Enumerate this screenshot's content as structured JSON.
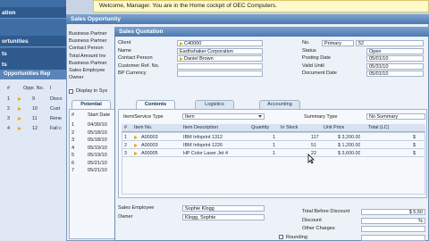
{
  "colors": {
    "title_bar": "#4d79b0",
    "sidebar": "#3f6ea5",
    "welcome_bg": "#fff8c8",
    "link_arrow": "#e0a820"
  },
  "sidebar": {
    "items": [
      "ation",
      "ortunities",
      "ts",
      "ts"
    ],
    "panel_title": "Opportunities Rep",
    "panel_cols": [
      "#",
      "Oppr. No.",
      "I"
    ],
    "panel_rows": [
      {
        "n": "1",
        "oppr": "9",
        "t": "Disco"
      },
      {
        "n": "2",
        "oppr": "10",
        "t": "Cust"
      },
      {
        "n": "3",
        "oppr": "11",
        "t": "Rene"
      },
      {
        "n": "4",
        "oppr": "12",
        "t": "Fall c"
      }
    ]
  },
  "welcome_text": "Welcome, Manager. You are in the Home cockpit of OEC Computers.",
  "opportunity": {
    "title": "Sales Opportunity",
    "labels": [
      "Business Partner",
      "Business Partner",
      "Contact Person",
      "Total Amount Inv",
      "Business Partner",
      "Sales Employee",
      "Owner"
    ],
    "checkbox_label": "Display in Sys",
    "tab_label": "Potential",
    "col_num": "#",
    "col_start": "Start Date",
    "dates": [
      "04/30/10",
      "05/18/10",
      "05/18/10",
      "05/19/10",
      "05/19/10",
      "05/21/10",
      "05/21/10"
    ]
  },
  "quotation": {
    "title": "Sales Quotation",
    "left": [
      {
        "label": "Client",
        "value": "C40000",
        "link": true
      },
      {
        "label": "Name",
        "value": "Earthshaker Corporation"
      },
      {
        "label": "Contact Person",
        "value": "Daniel Brown",
        "link": true
      },
      {
        "label": "Customer Ref. No.",
        "value": ""
      },
      {
        "label": "BP Currency",
        "value": ""
      }
    ],
    "right": [
      {
        "label": "No.",
        "series": "Primary",
        "value": "52"
      },
      {
        "label": "Status",
        "value": "Open"
      },
      {
        "label": "Posting Date",
        "value": "05/01/10"
      },
      {
        "label": "Valid Until",
        "value": "05/31/10"
      },
      {
        "label": "Document Date",
        "value": "05/01/10"
      }
    ],
    "tabs": [
      "Contents",
      "Logistics",
      "Accounting"
    ],
    "item_type_label": "Item/Service Type",
    "item_type_value": "Item",
    "summary_type_label": "Summary Type",
    "summary_type_value": "No Summary",
    "columns": [
      "#",
      "Item No.",
      "Item Description",
      "Quantity",
      "In Stock",
      "Unit Price",
      "Total (LC)"
    ],
    "rows": [
      {
        "n": "1",
        "item": "A00003",
        "desc": "IBM Infoprint 1312",
        "qty": "1",
        "stock": "117",
        "price": "$ 3,200.00",
        "total": "$"
      },
      {
        "n": "2",
        "item": "A00003",
        "desc": "IBM Infoprint 1226",
        "qty": "1",
        "stock": "51",
        "price": "$ 1,200.00",
        "total": "$"
      },
      {
        "n": "3",
        "item": "A00005",
        "desc": "HP Color Laser Jet 4",
        "qty": "1",
        "stock": "22",
        "price": "$ 3,600.00",
        "total": "$"
      }
    ],
    "bottom_left": [
      {
        "label": "Sales Employee",
        "value": "Sophie Klogg"
      },
      {
        "label": "Owner",
        "value": "Klogg, Sophie"
      }
    ],
    "bottom_right": [
      {
        "label": "Total Before Discount",
        "value": "$ 5,50"
      },
      {
        "label": "Discount",
        "value": "%"
      },
      {
        "label": "Other Charges",
        "value": ""
      },
      {
        "label": "Rounding",
        "value": ""
      }
    ]
  }
}
